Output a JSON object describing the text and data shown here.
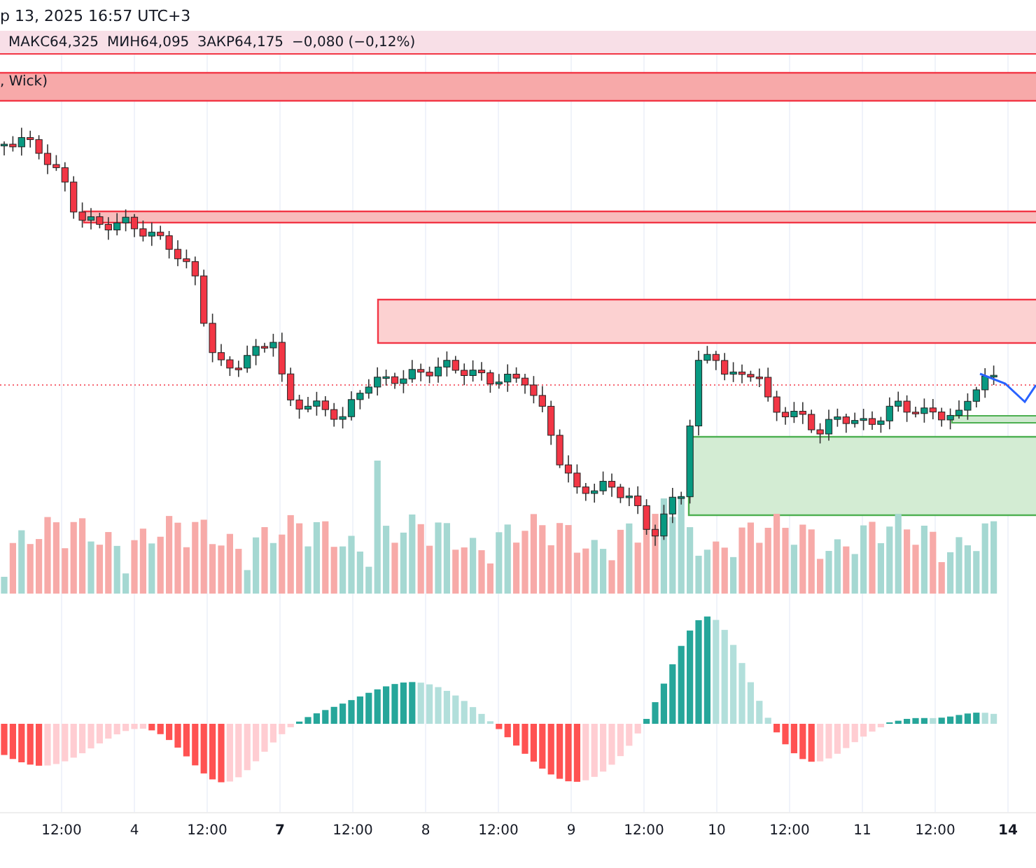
{
  "header": {
    "date_text": "р 13, 2025 16:57 UTC+3"
  },
  "ohlc": [
    "МАКС64,325",
    "МИН64,095",
    "ЗАКР64,175",
    "−0,080 (−0,12%)"
  ],
  "indicator_label": ", Wick)",
  "x_axis": [
    {
      "label": "12:00",
      "kind": "time"
    },
    {
      "label": "4",
      "kind": "day"
    },
    {
      "label": "12:00",
      "kind": "time"
    },
    {
      "label": "7",
      "kind": "week"
    },
    {
      "label": "12:00",
      "kind": "time"
    },
    {
      "label": "8",
      "kind": "day"
    },
    {
      "label": "12:00",
      "kind": "time"
    },
    {
      "label": "9",
      "kind": "day"
    },
    {
      "label": "12:00",
      "kind": "time"
    },
    {
      "label": "10",
      "kind": "day"
    },
    {
      "label": "12:00",
      "kind": "time"
    },
    {
      "label": "11",
      "kind": "day"
    },
    {
      "label": "12:00",
      "kind": "time"
    },
    {
      "label": "14",
      "kind": "week"
    }
  ]
}
